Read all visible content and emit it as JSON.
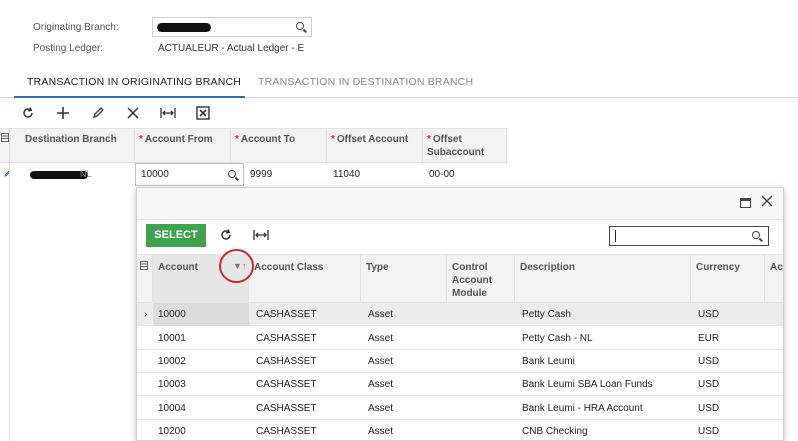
{
  "form": {
    "originating_branch_label": "Originating Branch:",
    "posting_ledger_label": "Posting Ledger:",
    "posting_ledger_value": "ACTUALEUR - Actual Ledger - E"
  },
  "tabs": [
    {
      "label": "TRANSACTION IN ORIGINATING BRANCH"
    },
    {
      "label": "TRANSACTION IN DESTINATION BRANCH"
    }
  ],
  "toolbar": {
    "icons": [
      "refresh-icon",
      "add-icon",
      "edit-icon",
      "delete-icon",
      "fit-columns-icon",
      "export-excel-icon"
    ]
  },
  "grid": {
    "headers": [
      "Destination Branch",
      "Account From",
      "Account To",
      "Offset Account",
      "Offset Subaccount"
    ],
    "required_marker": "*",
    "row": {
      "destination_branch_tail": "NL",
      "account_from": "10000",
      "account_to": "9999",
      "offset_account": "11040",
      "offset_subaccount": "00-00"
    }
  },
  "lookup": {
    "select_label": "SELECT",
    "search_value": "",
    "headers": [
      "Account",
      "Account Class",
      "Type",
      "Control Account Module",
      "Description",
      "Currency",
      "Ac"
    ],
    "rows": [
      {
        "account": "10000",
        "class": "CASHASSET",
        "type": "Asset",
        "module": "",
        "description": "Petty Cash",
        "currency": "USD"
      },
      {
        "account": "10001",
        "class": "CASHASSET",
        "type": "Asset",
        "module": "",
        "description": "Petty Cash - NL",
        "currency": "EUR"
      },
      {
        "account": "10002",
        "class": "CASHASSET",
        "type": "Asset",
        "module": "",
        "description": "Bank Leumi",
        "currency": "USD"
      },
      {
        "account": "10003",
        "class": "CASHASSET",
        "type": "Asset",
        "module": "",
        "description": "Bank Leumi SBA Loan Funds",
        "currency": "USD"
      },
      {
        "account": "10004",
        "class": "CASHASSET",
        "type": "Asset",
        "module": "",
        "description": "Bank Leumi - HRA Account",
        "currency": "USD"
      },
      {
        "account": "10200",
        "class": "CASHASSET",
        "type": "Asset",
        "module": "",
        "description": "CNB Checking",
        "currency": "USD"
      }
    ]
  },
  "colors": {
    "accent": "#2c6fb3",
    "select_button": "#3fa34d",
    "required": "#c0392b",
    "annotation_circle": "#d0262b"
  }
}
